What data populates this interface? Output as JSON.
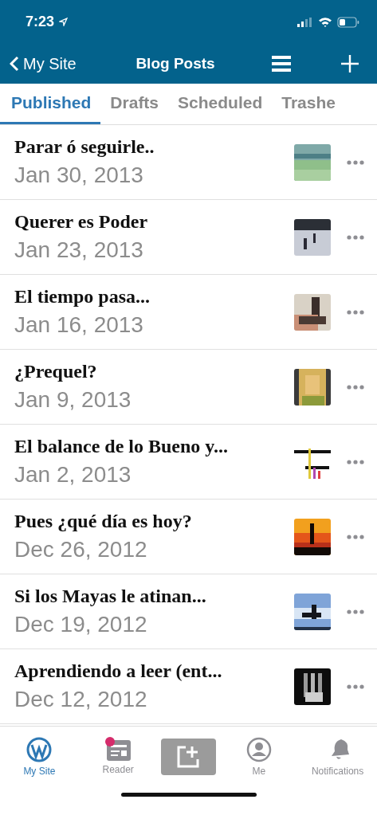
{
  "status_bar": {
    "time": "7:23"
  },
  "nav": {
    "back_label": "My Site",
    "title": "Blog Posts"
  },
  "tabs": [
    {
      "label": "Published",
      "selected": true
    },
    {
      "label": "Drafts",
      "selected": false
    },
    {
      "label": "Scheduled",
      "selected": false
    },
    {
      "label": "Trashe",
      "selected": false
    }
  ],
  "posts": [
    {
      "title": "Parar ó seguirle..",
      "date": "Jan 30, 2013"
    },
    {
      "title": "Querer es Poder",
      "date": "Jan 23, 2013"
    },
    {
      "title": "El tiempo pasa...",
      "date": "Jan 16, 2013"
    },
    {
      "title": "¿Prequel?",
      "date": "Jan 9, 2013"
    },
    {
      "title": "El balance de lo Bueno y...",
      "date": "Jan 2, 2013"
    },
    {
      "title": "Pues ¿qué día es hoy?",
      "date": "Dec 26, 2012"
    },
    {
      "title": "Si los Mayas le atinan...",
      "date": "Dec 19, 2012"
    },
    {
      "title": "Aprendiendo a leer (ent...",
      "date": "Dec 12, 2012"
    }
  ],
  "tab_bar": [
    {
      "kind": "mysite",
      "label": "My Site",
      "selected": true,
      "badge": false
    },
    {
      "kind": "reader",
      "label": "Reader",
      "selected": false,
      "badge": true
    },
    {
      "kind": "write",
      "selected": false,
      "badge": false
    },
    {
      "kind": "me",
      "label": "Me",
      "selected": false,
      "badge": false
    },
    {
      "kind": "notifications",
      "label": "Notifications",
      "selected": false,
      "badge": false
    }
  ]
}
